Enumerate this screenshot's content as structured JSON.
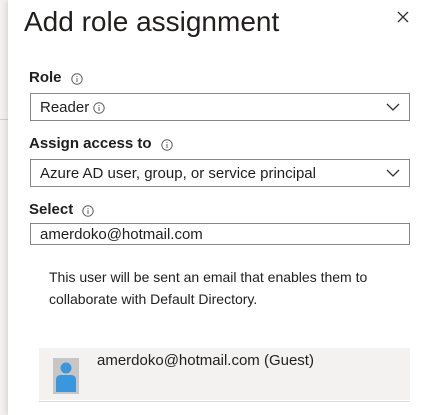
{
  "dialog": {
    "title": "Add role assignment"
  },
  "role": {
    "label": "Role",
    "value": "Reader"
  },
  "assign_access": {
    "label": "Assign access to",
    "value": "Azure AD user, group, or service principal"
  },
  "select": {
    "label": "Select",
    "value": "amerdoko@hotmail.com"
  },
  "notice": {
    "text": "This user will be sent an email that enables them to collaborate with Default Directory."
  },
  "result": {
    "text": "amerdoko@hotmail.com (Guest)"
  },
  "colors": {
    "avatar_accent": "#3a96dd",
    "input_border": "#8a8886",
    "result_background": "#f3f2f1"
  }
}
